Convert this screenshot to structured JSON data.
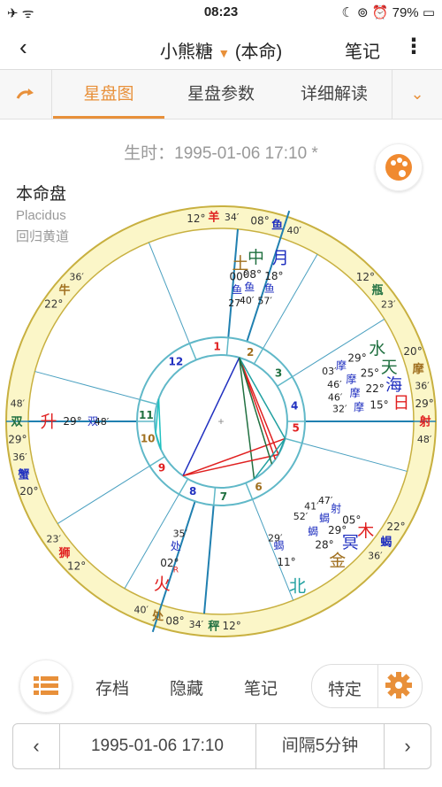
{
  "status": {
    "time": "08:23",
    "battery": "79%",
    "left_icons": "✈ ᯤ",
    "right_icons": "☾ ⊚ ⏰"
  },
  "nav": {
    "back": "‹",
    "title": "小熊糖",
    "caret": "▼",
    "subtitle": "(本命)",
    "notes": "笔记",
    "more": "⋮"
  },
  "tabs": {
    "items": [
      "星盘图",
      "星盘参数",
      "详细解读"
    ],
    "active": 0
  },
  "birth": "生时：1995-01-06 17:10 *",
  "chart_label": {
    "title": "本命盘",
    "system": "Placidus",
    "zodiac": "回归黄道"
  },
  "chart": {
    "zodiac_ring": [
      {
        "deg": "12°",
        "sign": "羊",
        "color": "#e02020",
        "min": "34′"
      },
      {
        "deg": "08°",
        "sign": "鱼",
        "color": "#2030c0",
        "min": "40′"
      },
      {
        "deg": "12°",
        "sign": "瓶",
        "color": "#207040",
        "min": "23′"
      },
      {
        "deg": "20°",
        "sign": "摩",
        "color": "#a07020",
        "min": "36′"
      },
      {
        "deg": "29°",
        "sign": "射",
        "color": "#e02020",
        "min": "48′"
      },
      {
        "deg": "22°",
        "sign": "蝎",
        "color": "#2030c0",
        "min": "36′"
      },
      {
        "deg": "12°",
        "sign": "秤",
        "color": "#207040",
        "min": "34′"
      },
      {
        "deg": "08°",
        "sign": "处",
        "color": "#a07020",
        "min": "40′"
      },
      {
        "deg": "12°",
        "sign": "狮",
        "color": "#e02020",
        "min": "23′"
      },
      {
        "deg": "20°",
        "sign": "蟹",
        "color": "#2030c0",
        "min": "36′"
      },
      {
        "deg": "29°",
        "sign": "双",
        "color": "#207040",
        "min": "48′"
      },
      {
        "deg": "22°",
        "sign": "牛",
        "color": "#a07020",
        "min": "36′"
      }
    ],
    "houses": [
      "1",
      "2",
      "3",
      "4",
      "5",
      "6",
      "7",
      "8",
      "9",
      "10",
      "11",
      "12"
    ],
    "planets": [
      {
        "glyph": "月",
        "color": "#2030c0",
        "deg": "18°",
        "sign": "鱼",
        "min": "57′"
      },
      {
        "glyph": "中",
        "color": "#207040",
        "deg": "08°",
        "sign": "鱼",
        "min": "40′"
      },
      {
        "glyph": "土",
        "color": "#a07020",
        "deg": "00°",
        "sign": "鱼",
        "min": "27′"
      },
      {
        "glyph": "水",
        "color": "#207040",
        "deg": "29°",
        "sign": "摩",
        "min": "03′"
      },
      {
        "glyph": "天",
        "color": "#207040",
        "deg": "25°",
        "sign": "摩",
        "min": "46′"
      },
      {
        "glyph": "海",
        "color": "#2030c0",
        "deg": "22°",
        "sign": "摩",
        "min": "46′"
      },
      {
        "glyph": "日",
        "color": "#e02020",
        "deg": "15°",
        "sign": "摩",
        "min": "32′"
      },
      {
        "glyph": "木",
        "color": "#e02020",
        "deg": "05°",
        "sign": "射",
        "min": "47′"
      },
      {
        "glyph": "冥",
        "color": "#2030c0",
        "deg": "29°",
        "sign": "蝎",
        "min": "41′"
      },
      {
        "glyph": "金",
        "color": "#a07020",
        "deg": "28°",
        "sign": "蝎",
        "min": "52′"
      },
      {
        "glyph": "北",
        "color": "#20a0a0",
        "deg": "11°",
        "sign": "蝎",
        "min": "29′"
      },
      {
        "glyph": "火",
        "color": "#e02020",
        "deg": "02°",
        "sign": "处",
        "min": "35′"
      },
      {
        "glyph": "升",
        "color": "#e02020",
        "deg": "29°",
        "sign": "双",
        "min": "48′"
      }
    ],
    "retro": "R"
  },
  "toolbar": {
    "archive": "存档",
    "hide": "隐藏",
    "notes": "笔记",
    "special": "特定"
  },
  "bottom": {
    "prev": "‹",
    "datetime": "1995-01-06 17:10",
    "interval": "间隔5分钟",
    "next": "›"
  }
}
